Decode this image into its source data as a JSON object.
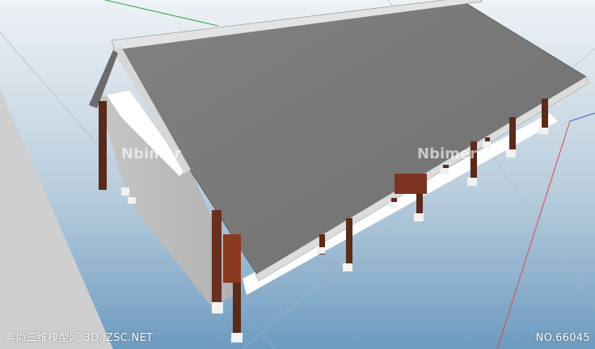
{
  "watermarks": {
    "center_brand": "Nbimer",
    "bottom_left": "典尚三维模型网 3D.JZSC.NET",
    "bottom_right": "NO.66045"
  },
  "colors": {
    "sky_top": "#dfe6ee",
    "sky_bottom": "#5d8fb8",
    "ground_plane": "#cfcfcf",
    "roof": "#7a7a7a",
    "roof_edge": "#d9d9d9",
    "gable_inside": "#ffffff",
    "wall": "#b8b8b8",
    "column": "#5a2a1a",
    "column_base": "#f2f2f2",
    "axis_green": "#34a34a",
    "axis_red": "#d4484a",
    "axis_blue": "#3b5bdb"
  }
}
